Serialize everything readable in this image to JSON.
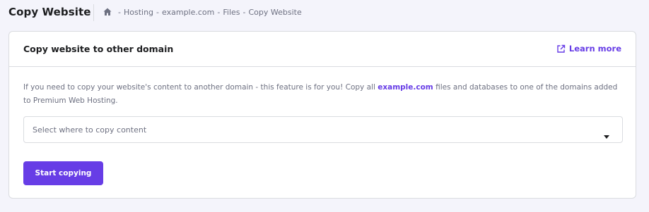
{
  "header": {
    "title": "Copy Website",
    "breadcrumb": [
      {
        "label": "Hosting"
      },
      {
        "label": "example.com"
      },
      {
        "label": "Files"
      },
      {
        "label": "Copy Website"
      }
    ],
    "breadcrumb_separator": "-",
    "home_icon": "home-icon"
  },
  "card": {
    "title": "Copy website to other domain",
    "learn_more_label": "Learn more",
    "learn_more_icon": "external-link-icon",
    "description_before": "If you need to copy your website's content to another domain - this feature is for you! Copy all ",
    "description_domain": "example.com",
    "description_after": " files and databases to one of the domains added to Premium Web Hosting.",
    "select": {
      "placeholder": "Select where to copy content",
      "icon": "chevron-down-icon"
    },
    "submit_label": "Start copying"
  },
  "colors": {
    "accent": "#673de6",
    "background": "#f4f4fb",
    "text_dark": "#1d1e20",
    "text_muted": "#6d7081",
    "border": "#dadce0"
  }
}
